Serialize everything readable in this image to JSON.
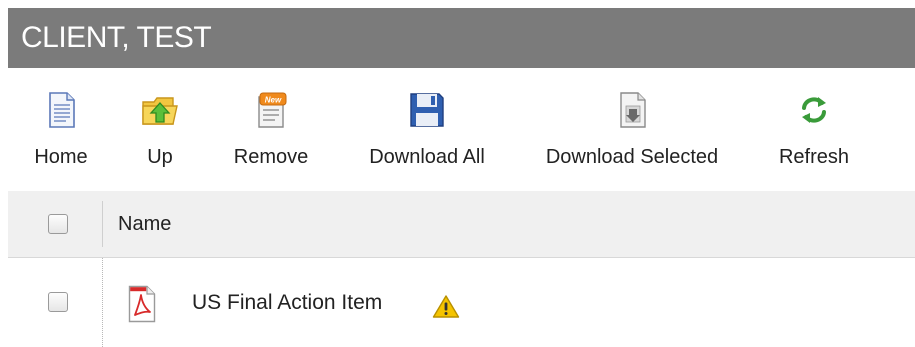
{
  "window": {
    "title": "CLIENT, TEST"
  },
  "toolbar": {
    "items": [
      {
        "label": "Home",
        "icon": "home-document-icon"
      },
      {
        "label": "Up",
        "icon": "up-folder-icon"
      },
      {
        "label": "Remove",
        "icon": "remove-new-icon"
      },
      {
        "label": "Download All",
        "icon": "floppy-disk-icon"
      },
      {
        "label": "Download Selected",
        "icon": "download-document-icon"
      },
      {
        "label": "Refresh",
        "icon": "refresh-icon"
      }
    ]
  },
  "grid": {
    "columns": [
      {
        "label": "Name"
      }
    ],
    "rows": [
      {
        "name": "US Final Action Item",
        "file_icon": "pdf-icon",
        "status_icon": "warning-icon",
        "selected": false
      }
    ]
  },
  "colors": {
    "title_bar_bg": "#7b7b7b",
    "header_bg": "#f0f0f0",
    "refresh_green": "#3a9b3a",
    "warning_yellow": "#f5c400",
    "pdf_red": "#d82a2a",
    "floppy_blue": "#2f5fb0"
  }
}
